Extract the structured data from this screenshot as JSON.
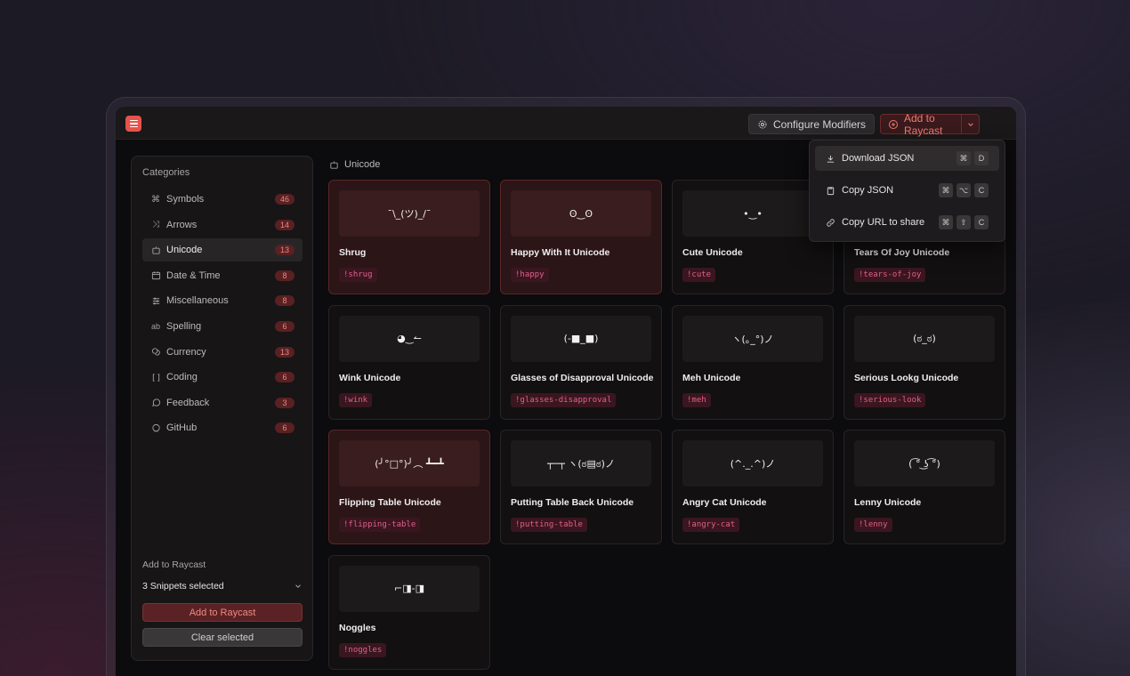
{
  "toolbar": {
    "configure_label": "Configure Modifiers",
    "add_label": "Add to Raycast"
  },
  "sidebar": {
    "heading": "Categories",
    "items": [
      {
        "label": "Symbols",
        "count": "46",
        "icon": "command-icon"
      },
      {
        "label": "Arrows",
        "count": "14",
        "icon": "shuffle-icon"
      },
      {
        "label": "Unicode",
        "count": "13",
        "icon": "robot-icon",
        "active": true
      },
      {
        "label": "Date & Time",
        "count": "8",
        "icon": "calendar-icon"
      },
      {
        "label": "Miscellaneous",
        "count": "8",
        "icon": "sliders-icon"
      },
      {
        "label": "Spelling",
        "count": "6",
        "icon": "text-ab-icon"
      },
      {
        "label": "Currency",
        "count": "13",
        "icon": "coins-icon"
      },
      {
        "label": "Coding",
        "count": "6",
        "icon": "code-bracket-icon"
      },
      {
        "label": "Feedback",
        "count": "3",
        "icon": "speech-bubble-icon"
      },
      {
        "label": "GitHub",
        "count": "6",
        "icon": "github-icon"
      }
    ],
    "bottom": {
      "heading": "Add to Raycast",
      "selected": "3 Snippets selected",
      "add_button": "Add to Raycast",
      "clear_button": "Clear selected"
    }
  },
  "section": {
    "title": "Unicode"
  },
  "cards": [
    {
      "preview": "¯\\_(ツ)_/¯",
      "title": "Shrug",
      "tag": "!shrug",
      "selected": true
    },
    {
      "preview": "ʘ‿ʘ",
      "title": "Happy With It Unicode",
      "tag": "!happy",
      "selected": true
    },
    {
      "preview": "•‿•",
      "title": "Cute Unicode",
      "tag": "!cute",
      "selected": false
    },
    {
      "preview": "",
      "title": "Tears Of Joy Unicode",
      "tag": "!tears-of-joy",
      "selected": false
    },
    {
      "preview": "◕‿↼",
      "title": "Wink Unicode",
      "tag": "!wink",
      "selected": false
    },
    {
      "preview": "(-■_■)",
      "title": "Glasses of Disapproval Unicode",
      "tag": "!glasses-disapproval",
      "selected": false
    },
    {
      "preview": "ヽ(｡_°)ノ",
      "title": "Meh Unicode",
      "tag": "!meh",
      "selected": false
    },
    {
      "preview": "(ಠ_ಠ)",
      "title": "Serious Lookg Unicode",
      "tag": "!serious-look",
      "selected": false
    },
    {
      "preview": "(╯°□°)╯︵ ┻━┻",
      "title": "Flipping Table Unicode",
      "tag": "!flipping-table",
      "selected": true
    },
    {
      "preview": "┬─┬ ヽ(ಠ▤ಠ)ノ",
      "title": "Putting Table Back Unicode",
      "tag": "!putting-table",
      "selected": false
    },
    {
      "preview": "(^._.^)ノ",
      "title": "Angry Cat Unicode",
      "tag": "!angry-cat",
      "selected": false
    },
    {
      "preview": "( ͡° ͜ʖ ͡°)",
      "title": "Lenny Unicode",
      "tag": "!lenny",
      "selected": false
    },
    {
      "preview": "⌐◨-◨",
      "title": "Noggles",
      "tag": "!noggles",
      "selected": false
    }
  ],
  "dropdown": {
    "items": [
      {
        "label": "Download JSON",
        "keys": [
          "⌘",
          "D"
        ],
        "icon": "download-icon"
      },
      {
        "label": "Copy JSON",
        "keys": [
          "⌘",
          "⌥",
          "C"
        ],
        "icon": "clipboard-icon"
      },
      {
        "label": "Copy URL to share",
        "keys": [
          "⌘",
          "⇧",
          "C"
        ],
        "icon": "link-icon"
      }
    ]
  },
  "colors": {
    "accent": "#e5534b",
    "tag_text": "#e0608a",
    "background": "#0c0b0d"
  }
}
